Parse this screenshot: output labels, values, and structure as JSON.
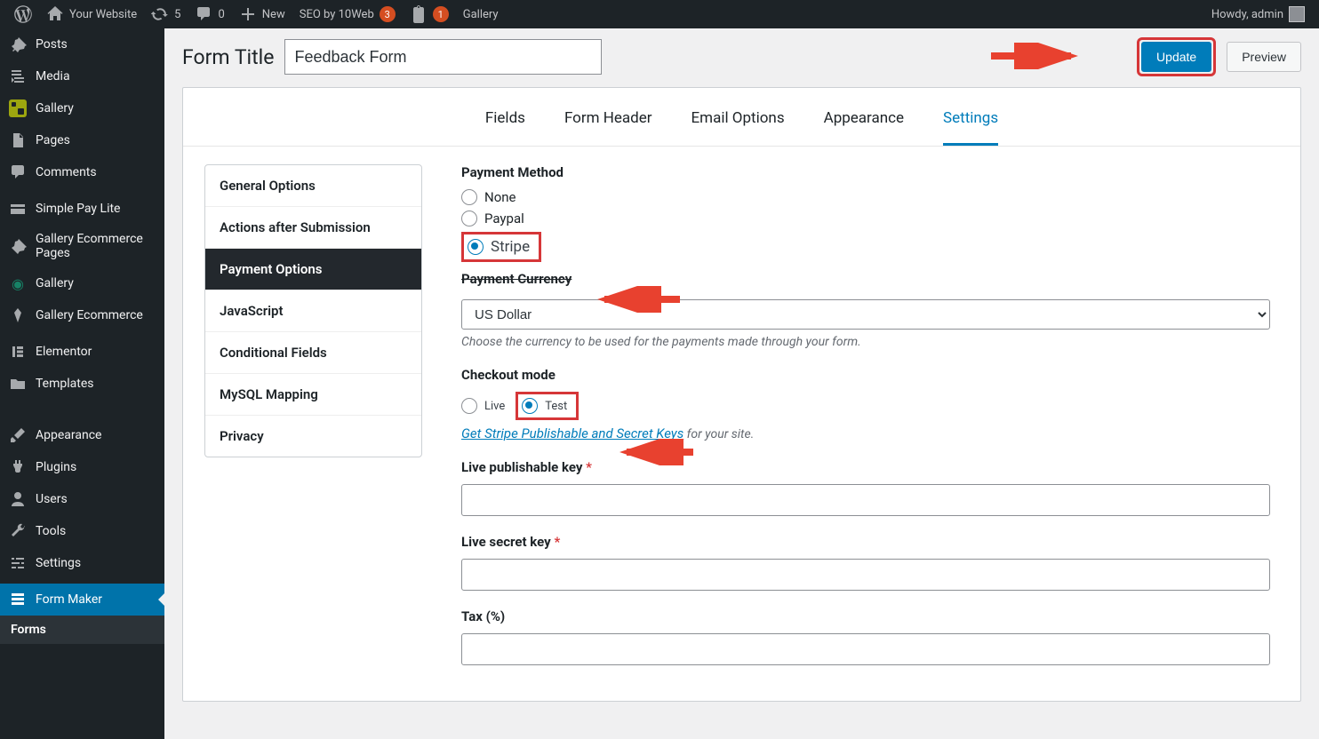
{
  "adminbar": {
    "site_name": "Your Website",
    "updates_count": "5",
    "comments_count": "0",
    "new_label": "New",
    "seo_label": "SEO by 10Web",
    "seo_count": "3",
    "yoast_count": "1",
    "gallery_label": "Gallery",
    "howdy": "Howdy, admin"
  },
  "adminmenu": {
    "items": [
      "Posts",
      "Media",
      "Gallery",
      "Pages",
      "Comments",
      "Simple Pay Lite",
      "Gallery Ecommerce Pages",
      "Gallery",
      "Gallery Ecommerce",
      "Elementor",
      "Templates",
      "Appearance",
      "Plugins",
      "Users",
      "Tools",
      "Settings",
      "Form Maker"
    ],
    "submenu_current": "Forms"
  },
  "header": {
    "form_title_label": "Form Title",
    "form_title_value": "Feedback Form",
    "update_btn": "Update",
    "preview_btn": "Preview"
  },
  "tabs": [
    "Fields",
    "Form Header",
    "Email Options",
    "Appearance",
    "Settings"
  ],
  "side_tabs": [
    "General Options",
    "Actions after Submission",
    "Payment Options",
    "JavaScript",
    "Conditional Fields",
    "MySQL Mapping",
    "Privacy"
  ],
  "form": {
    "payment_method_label": "Payment Method",
    "pm_none": "None",
    "pm_paypal": "Paypal",
    "pm_stripe": "Stripe",
    "payment_currency_label": "Payment Currency",
    "currency_value": "US Dollar",
    "currency_hint": "Choose the currency to be used for the payments made through your form.",
    "checkout_mode_label": "Checkout mode",
    "cm_live": "Live",
    "cm_test": "Test",
    "stripe_keys_link": "Get Stripe Publishable and Secret Keys",
    "stripe_keys_tail": " for your site.",
    "live_pub_label": "Live publishable key ",
    "live_secret_label": "Live secret key ",
    "tax_label": "Tax (%)"
  }
}
